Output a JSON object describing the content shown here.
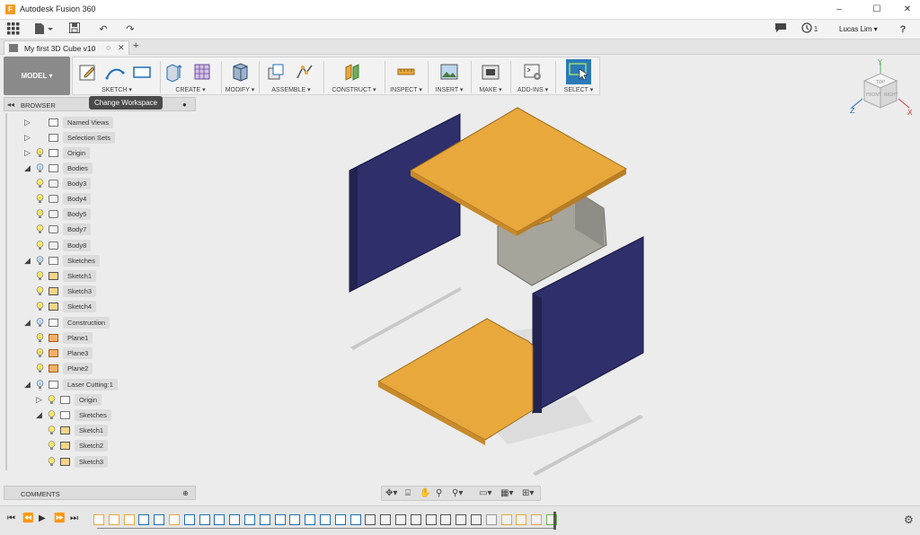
{
  "window": {
    "title": "Autodesk Fusion 360",
    "minimize": "–",
    "maximize": "☐",
    "close": "✕"
  },
  "quick_access": {
    "undo": "↶",
    "redo": "↷",
    "clock_count": "1",
    "user": "Lucas Lim ▾",
    "help": "?"
  },
  "document": {
    "tab_title": "My first 3D Cube v10",
    "close": "✕",
    "new_tab": "+"
  },
  "toolbar": {
    "workspace": "MODEL ▾",
    "groups": [
      {
        "label": "SKETCH ▾"
      },
      {
        "label": "CREATE ▾"
      },
      {
        "label": "MODIFY ▾"
      },
      {
        "label": "ASSEMBLE ▾"
      },
      {
        "label": "CONSTRUCT ▾"
      },
      {
        "label": "INSPECT ▾"
      },
      {
        "label": "INSERT ▾"
      },
      {
        "label": "MAKE ▾"
      },
      {
        "label": "ADD-INS ▾"
      },
      {
        "label": "SELECT ▾"
      }
    ],
    "tooltip": "Change Workspace"
  },
  "browser": {
    "title": "BROWSER",
    "collapse": "◂◂",
    "items": [
      {
        "label": "Named Views",
        "expander": "▷"
      },
      {
        "label": "Selection Sets",
        "expander": "▷"
      },
      {
        "label": "Origin",
        "expander": "▷"
      },
      {
        "label": "Bodies",
        "expander": "◢"
      },
      {
        "label": "Body3"
      },
      {
        "label": "Body4"
      },
      {
        "label": "Body5"
      },
      {
        "label": "Body7"
      },
      {
        "label": "Body8"
      },
      {
        "label": "Sketches",
        "expander": "◢"
      },
      {
        "label": "Sketch1"
      },
      {
        "label": "Sketch3"
      },
      {
        "label": "Sketch4"
      },
      {
        "label": "Construction",
        "expander": "◢"
      },
      {
        "label": "Plane1"
      },
      {
        "label": "Plane3"
      },
      {
        "label": "Plane2"
      },
      {
        "label": "Laser Cutting:1",
        "expander": "◢"
      },
      {
        "label": "Origin",
        "expander": "▷"
      },
      {
        "label": "Sketches",
        "expander": "◢"
      },
      {
        "label": "Sketch1"
      },
      {
        "label": "Sketch2"
      },
      {
        "label": "Sketch3"
      }
    ]
  },
  "comments": {
    "title": "COMMENTS"
  },
  "viewcube": {
    "top": "TOP",
    "front": "FRONT",
    "right": "RIGHT",
    "x": "X",
    "y": "Y",
    "z": "Z"
  },
  "colors": {
    "panel_navy": "#2e2f6b",
    "panel_orange": "#e8a83c",
    "panel_gray": "#a6a49b",
    "accent_blue": "#1e6fb5"
  }
}
